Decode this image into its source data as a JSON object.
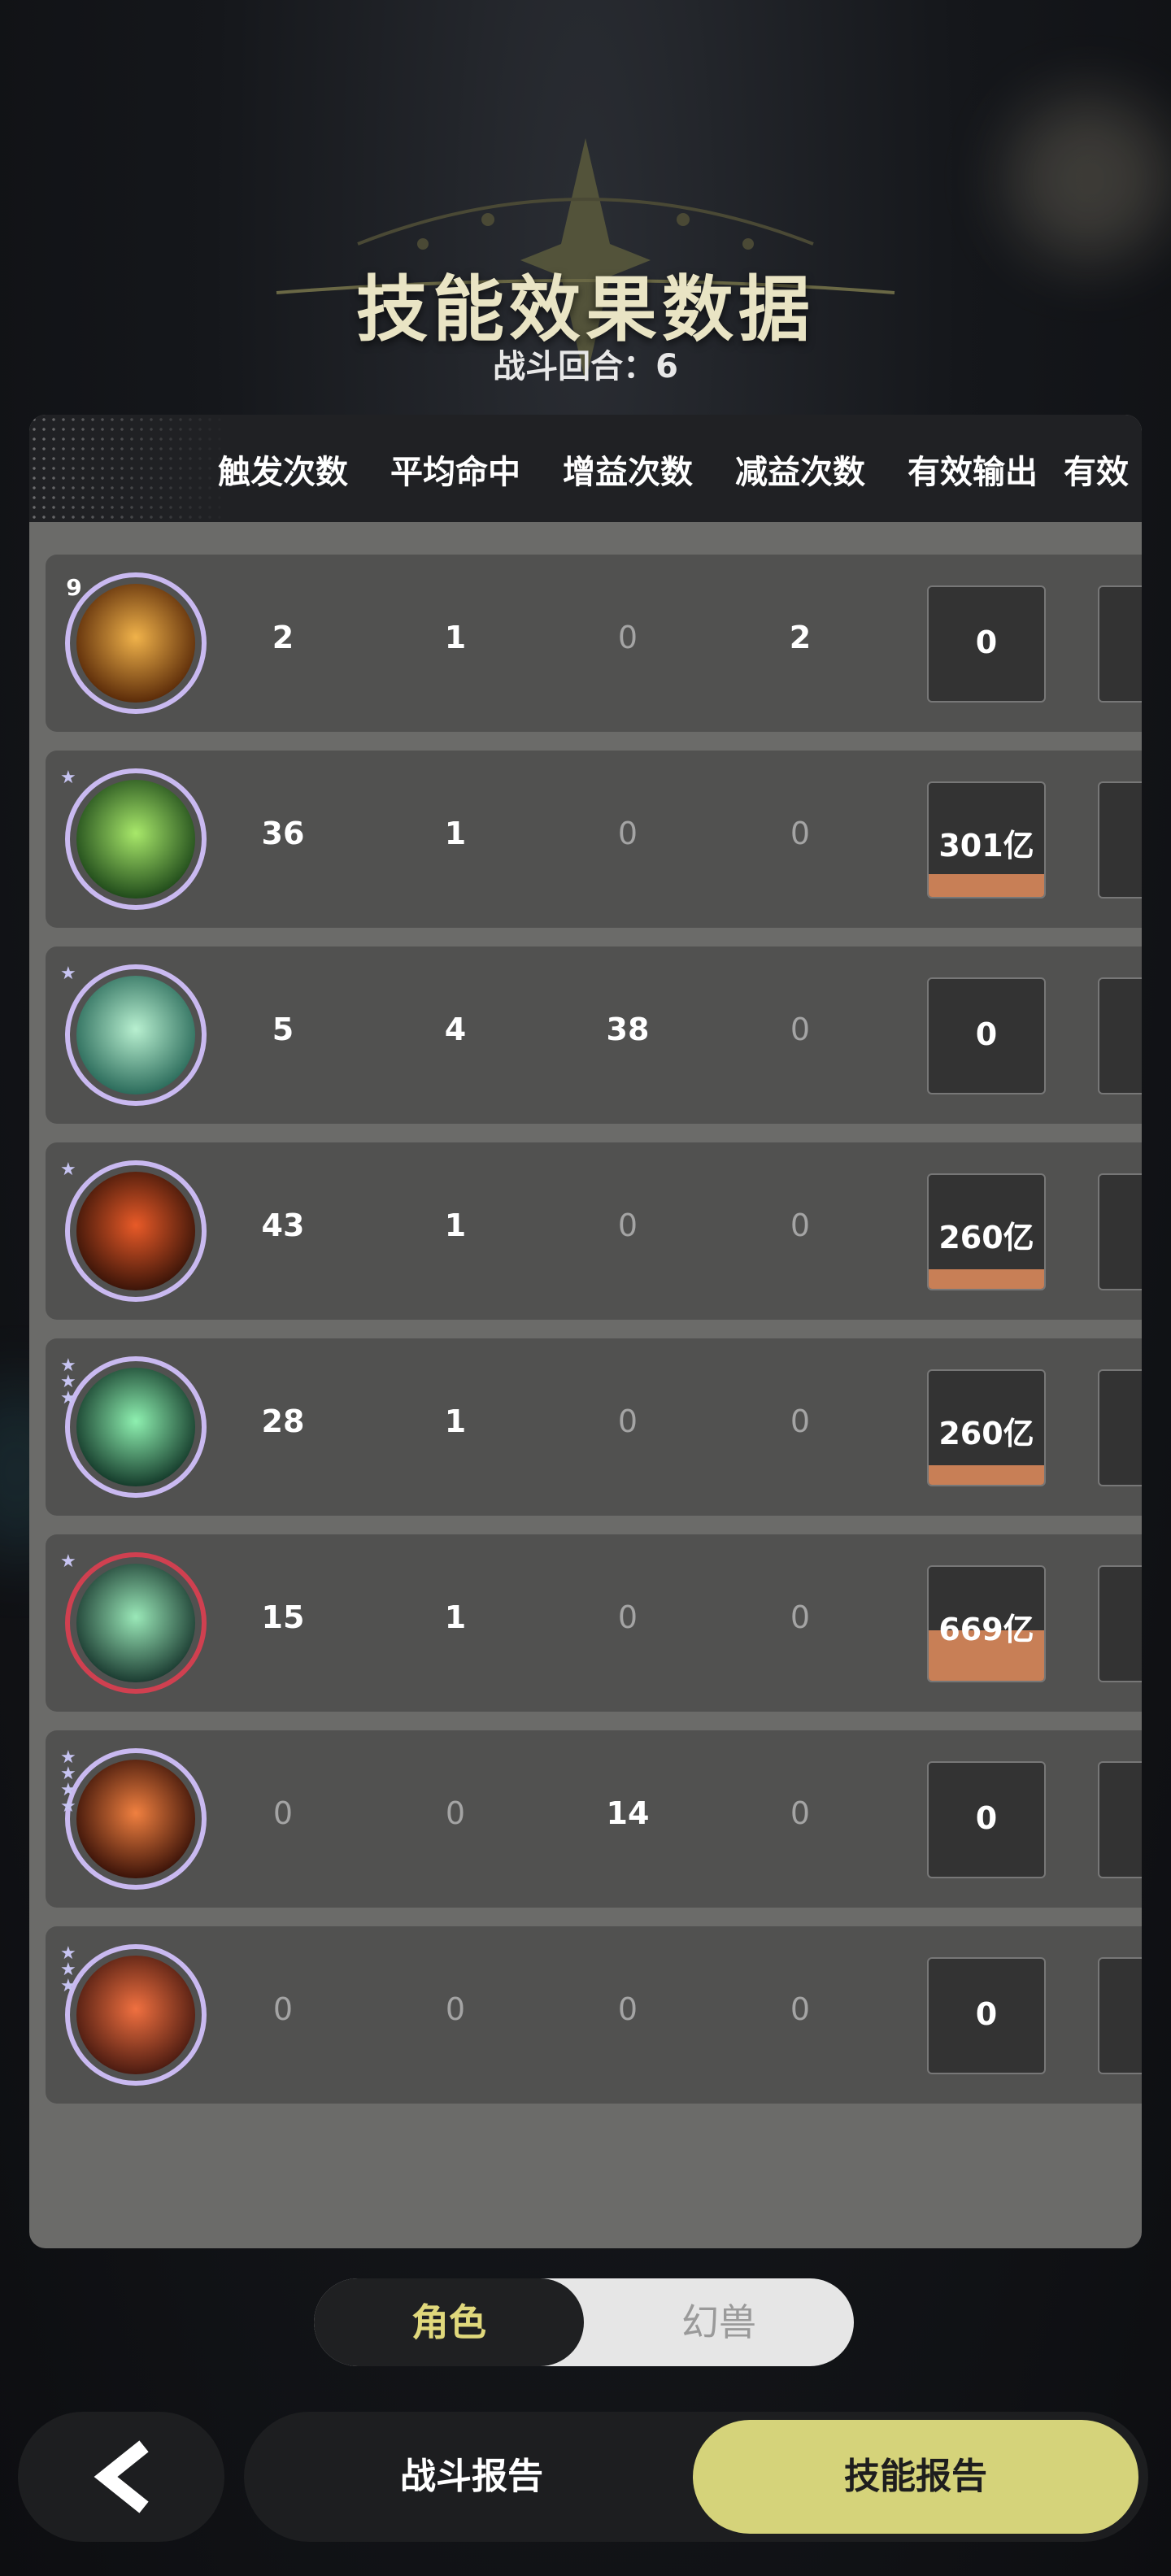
{
  "header": {
    "title": "技能效果数据",
    "round_label": "战斗回合：6"
  },
  "columns": [
    "触发次数",
    "平均命中",
    "增益次数",
    "减益次数",
    "有效输出",
    "有效"
  ],
  "rows": [
    {
      "icon": "golden-crescent-icon",
      "badge": "9",
      "stars": "",
      "ring": "#c9b9f0",
      "colors": [
        "#f0b24a",
        "#5a2a08"
      ],
      "trigger": "2",
      "hit": "1",
      "buff": "0",
      "debuff": "2",
      "output": "0",
      "output_fill": 0
    },
    {
      "icon": "green-vortex-icon",
      "badge": "",
      "stars": "★",
      "ring": "#c9b9f0",
      "colors": [
        "#a8e86a",
        "#1f4a1a"
      ],
      "trigger": "36",
      "hit": "1",
      "buff": "0",
      "debuff": "0",
      "output": "301亿",
      "output_fill": 0.2
    },
    {
      "icon": "teal-arrows-icon",
      "badge": "",
      "stars": "★",
      "ring": "#c9b9f0",
      "colors": [
        "#b8f0d0",
        "#2a6a5a"
      ],
      "trigger": "5",
      "hit": "4",
      "buff": "38",
      "debuff": "0",
      "output": "0",
      "output_fill": 0
    },
    {
      "icon": "fire-icon",
      "badge": "",
      "stars": "★",
      "ring": "#c9b9f0",
      "colors": [
        "#e85a28",
        "#3a1408"
      ],
      "trigger": "43",
      "hit": "1",
      "buff": "0",
      "debuff": "0",
      "output": "260亿",
      "output_fill": 0.17
    },
    {
      "icon": "green-crystal-icon",
      "badge": "",
      "stars": "★★★",
      "ring": "#c9b9f0",
      "colors": [
        "#8ef0b0",
        "#143a2a"
      ],
      "trigger": "28",
      "hit": "1",
      "buff": "0",
      "debuff": "0",
      "output": "260亿",
      "output_fill": 0.17
    },
    {
      "icon": "green-blades-icon",
      "badge": "",
      "stars": "★",
      "ring": "#d04050",
      "colors": [
        "#9ae8b8",
        "#1a3a30"
      ],
      "trigger": "15",
      "hit": "1",
      "buff": "0",
      "debuff": "0",
      "output": "669亿",
      "output_fill": 0.44
    },
    {
      "icon": "fire-sword-icon",
      "badge": "",
      "stars": "★★★★",
      "ring": "#c9b9f0",
      "colors": [
        "#f08040",
        "#3a1208"
      ],
      "trigger": "0",
      "hit": "0",
      "buff": "14",
      "debuff": "0",
      "output": "0",
      "output_fill": 0
    },
    {
      "icon": "fire-spirit-icon",
      "badge": "",
      "stars": "★★★",
      "ring": "#c9b9f0",
      "colors": [
        "#f07040",
        "#4a1a10"
      ],
      "trigger": "0",
      "hit": "0",
      "buff": "0",
      "debuff": "0",
      "output": "0",
      "output_fill": 0
    }
  ],
  "toggle": {
    "left": "角色",
    "right": "幻兽"
  },
  "bottom": {
    "back_icon": "back-arrow-icon",
    "battle_report": "战斗报告",
    "skill_report": "技能报告"
  },
  "colors": {
    "accent": "#d5d37a",
    "output_fill": "#c87f56"
  }
}
